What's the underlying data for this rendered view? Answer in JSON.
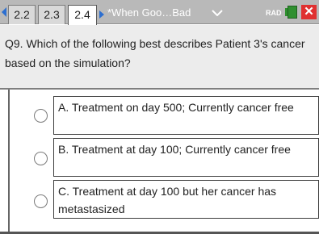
{
  "toolbar": {
    "tabs": [
      {
        "label": "2.2",
        "active": false
      },
      {
        "label": "2.3",
        "active": false
      },
      {
        "label": "2.4",
        "active": true
      }
    ],
    "document_title": "*When Goo…Bad",
    "angle_mode": "RAD",
    "close_label": "✕"
  },
  "question": {
    "text": "Q9. Which of the following best describes Patient 3's cancer based on the simulation?"
  },
  "options": [
    {
      "label": "A. Treatment on day 500; Currently cancer free",
      "selected": false
    },
    {
      "label": "B. Treatment at day 100; Currently cancer free",
      "selected": false
    },
    {
      "label": "C. Treatment at day 100 but her cancer has metastasized",
      "selected": false
    }
  ],
  "colors": {
    "toolbar": "#b9b9b9",
    "accent": "#2d6fd0",
    "close": "#e03030",
    "battery": "#2f8f2f"
  }
}
